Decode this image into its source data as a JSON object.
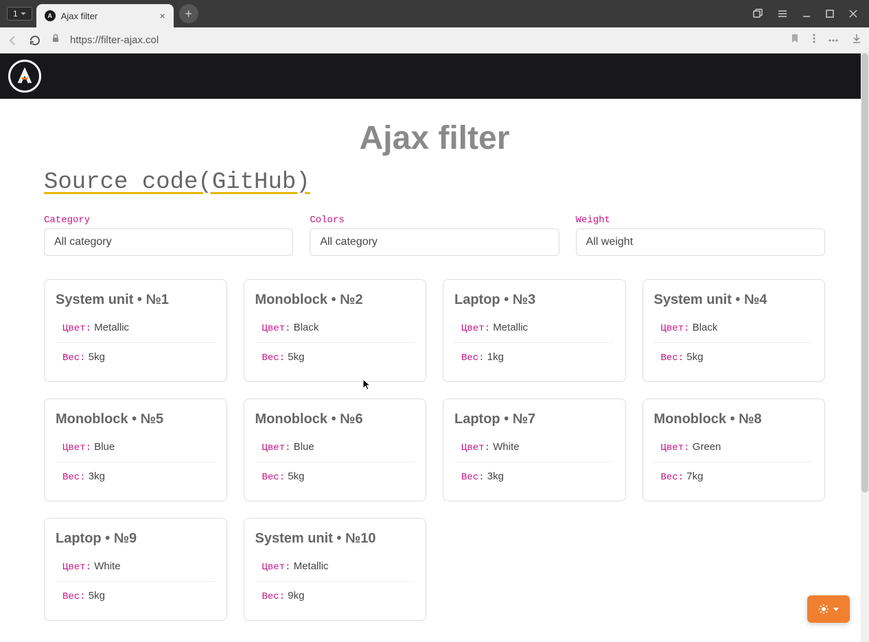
{
  "browser": {
    "tab_counter": "1",
    "tab_title": "Ajax filter",
    "url": "https://filter-ajax.col"
  },
  "page": {
    "title": "Ajax filter",
    "source_link": "Source code(GitHub)"
  },
  "filters": {
    "category": {
      "label": "Category",
      "value": "All category"
    },
    "colors": {
      "label": "Colors",
      "value": "All category"
    },
    "weight": {
      "label": "Weight",
      "value": "All weight"
    }
  },
  "labels": {
    "color": "Цвет:",
    "weight": "Вес:"
  },
  "products": [
    {
      "title": "System unit • №1",
      "color": "Metallic",
      "weight": "5kg"
    },
    {
      "title": "Monoblock • №2",
      "color": "Black",
      "weight": "5kg"
    },
    {
      "title": "Laptop • №3",
      "color": "Metallic",
      "weight": "1kg"
    },
    {
      "title": "System unit • №4",
      "color": "Black",
      "weight": "5kg"
    },
    {
      "title": "Monoblock • №5",
      "color": "Blue",
      "weight": "3kg"
    },
    {
      "title": "Monoblock • №6",
      "color": "Blue",
      "weight": "5kg"
    },
    {
      "title": "Laptop • №7",
      "color": "White",
      "weight": "3kg"
    },
    {
      "title": "Monoblock • №8",
      "color": "Green",
      "weight": "7kg"
    },
    {
      "title": "Laptop • №9",
      "color": "White",
      "weight": "5kg"
    },
    {
      "title": "System unit • №10",
      "color": "Metallic",
      "weight": "9kg"
    }
  ]
}
